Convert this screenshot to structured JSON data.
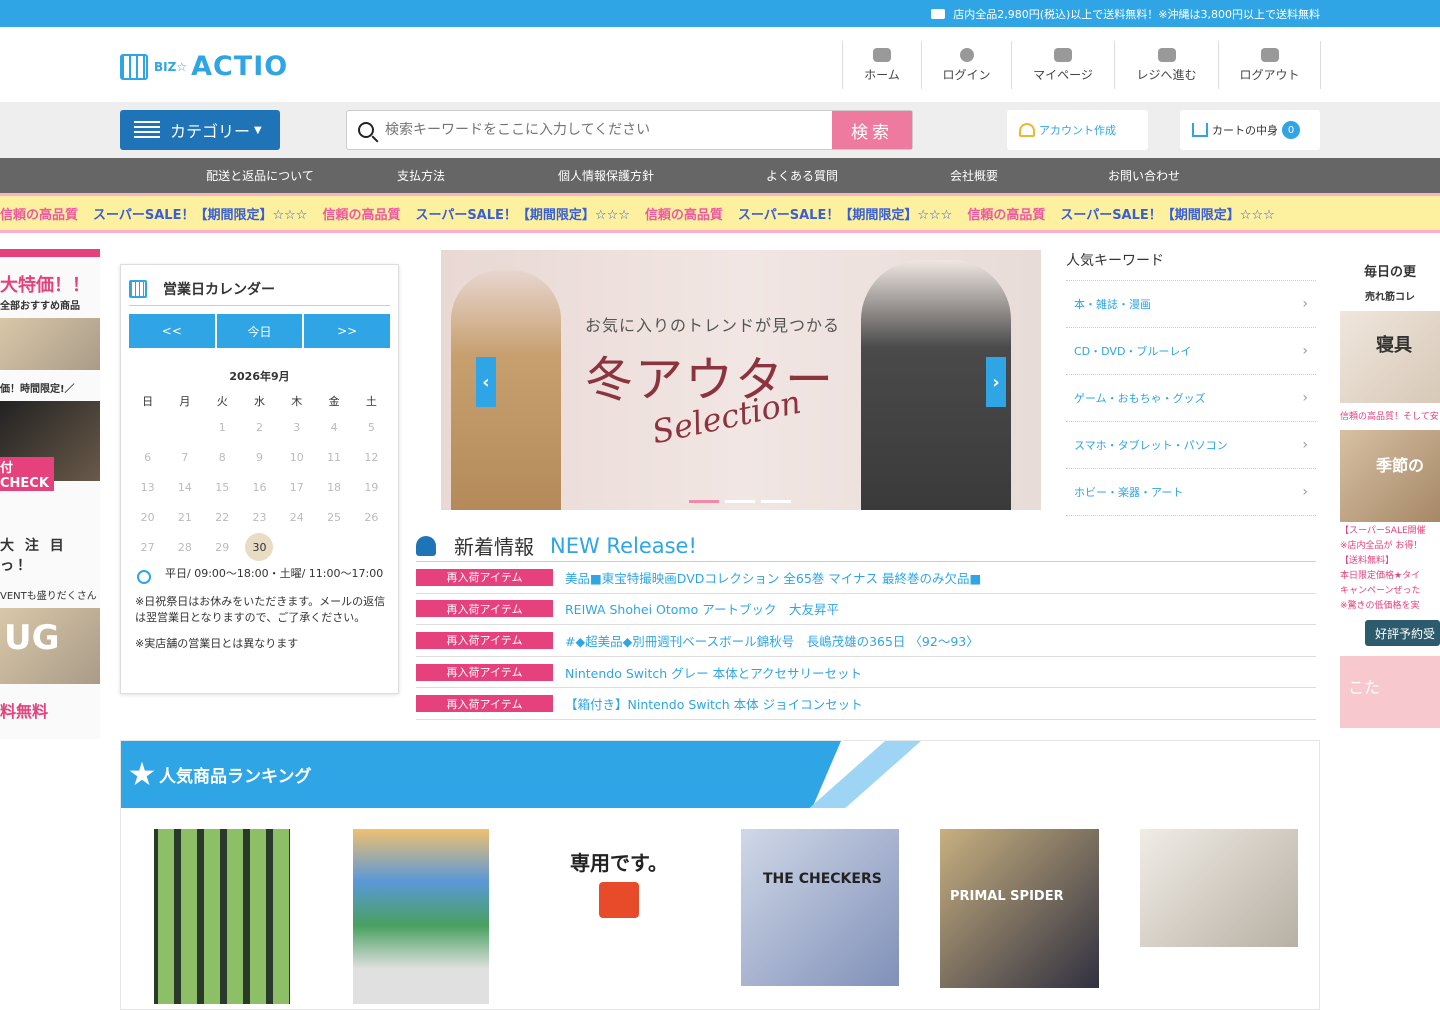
{
  "topbar": {
    "notice": "店内全品2,980円(税込)以上で送料無料！※沖縄は3,800円以上で送料無料"
  },
  "header": {
    "logo_small": "BIZ☆",
    "logo_main": "ACTIO",
    "nav": [
      {
        "label": "ホーム",
        "icon": "home-icon"
      },
      {
        "label": "ログイン",
        "icon": "user-icon"
      },
      {
        "label": "マイページ",
        "icon": "id-card-icon"
      },
      {
        "label": "レジへ進む",
        "icon": "register-icon"
      },
      {
        "label": "ログアウト",
        "icon": "logout-icon"
      }
    ]
  },
  "search": {
    "category_label": "カテゴリー",
    "placeholder": "検索キーワードをここに入力してください",
    "button": "検索",
    "account": "アカウント作成",
    "cart_label": "カートの中身",
    "cart_count": "0"
  },
  "subnav": [
    "配送と返品について",
    "支払方法",
    "個人情報保護方針",
    "よくある質問",
    "会社概要",
    "お問い合わせ"
  ],
  "banner": {
    "text_a": "信頼の高品質",
    "text_b": "スーパーSALE！【期間限定】☆☆☆"
  },
  "left_strip": {
    "t1": "大特価！！",
    "t1b": "全部おすすめ商品",
    "t2": "価！時間限定!／",
    "t3": "付CHECK",
    "t4": "大 注 目 っ！",
    "t5": "VENTも盛りだくさん",
    "t6": "UG",
    "t7": "料無料"
  },
  "calendar": {
    "title": "営業日カレンダー",
    "prev": "<<",
    "today_btn": "今日",
    "next": ">>",
    "month": "2026年9月",
    "dow": [
      "日",
      "月",
      "火",
      "水",
      "木",
      "金",
      "土"
    ],
    "days": [
      "",
      "",
      "1",
      "2",
      "3",
      "4",
      "5",
      "6",
      "7",
      "8",
      "9",
      "10",
      "11",
      "12",
      "13",
      "14",
      "15",
      "16",
      "17",
      "18",
      "19",
      "20",
      "21",
      "22",
      "23",
      "24",
      "25",
      "26",
      "27",
      "28",
      "29",
      "30",
      "",
      "",
      ""
    ],
    "today": "30",
    "hours": "平日/ 09:00～18:00・土曜/ 11:00～17:00",
    "note1": "※日祝祭日はお休みをいただきます。メールの返信は翌営業日となりますので、ご了承ください。",
    "note2": "※実店舗の営業日とは異なります"
  },
  "hero": {
    "t1": "お気に入りのトレンドが見つかる",
    "t2": "冬アウター",
    "t3": "Selection"
  },
  "popular_keywords": {
    "title": "人気キーワード",
    "items": [
      "本・雑誌・漫画",
      "CD・DVD・ブルーレイ",
      "ゲーム・おもちゃ・グッズ",
      "スマホ・タブレット・パソコン",
      "ホビー・楽器・アート"
    ]
  },
  "right_strip": {
    "h1": "毎日の更",
    "h2": "売れ筋コレ",
    "img1": "寝具",
    "cap1": "信頼の高品質！そして安",
    "img2": "季節の",
    "lines": [
      "【スーパーSALE開催",
      "※店内全品が お得！",
      "【送料無料】",
      "本日限定価格★タイ",
      "キャンペーンぜった",
      "※驚きの低価格を実"
    ],
    "btn": "好評予約受",
    "img3": "こた"
  },
  "news": {
    "title_jp": "新着情報",
    "title_en": "NEW Release!",
    "items": [
      {
        "tag": "再入荷アイテム",
        "text": "美品■東宝特撮映画DVDコレクション 全65巻 マイナス 最終巻のみ欠品■"
      },
      {
        "tag": "再入荷アイテム",
        "text": "REIWA Shohei Otomo アートブック　大友昇平"
      },
      {
        "tag": "再入荷アイテム",
        "text": "#◆超美品◆別冊週刊ベースボール錦秋号　長嶋茂雄の365日 〈92～93〉"
      },
      {
        "tag": "再入荷アイテム",
        "text": "Nintendo Switch グレー 本体とアクセサリーセット"
      },
      {
        "tag": "再入荷アイテム",
        "text": "【箱付き】Nintendo Switch 本体 ジョイコンセット"
      }
    ]
  },
  "ranking": {
    "title": "人気商品ランキング",
    "thumb3_text": "専用です。",
    "thumb4_text": "THE CHECKERS",
    "thumb5_text": "PRIMAL SPIDER"
  }
}
